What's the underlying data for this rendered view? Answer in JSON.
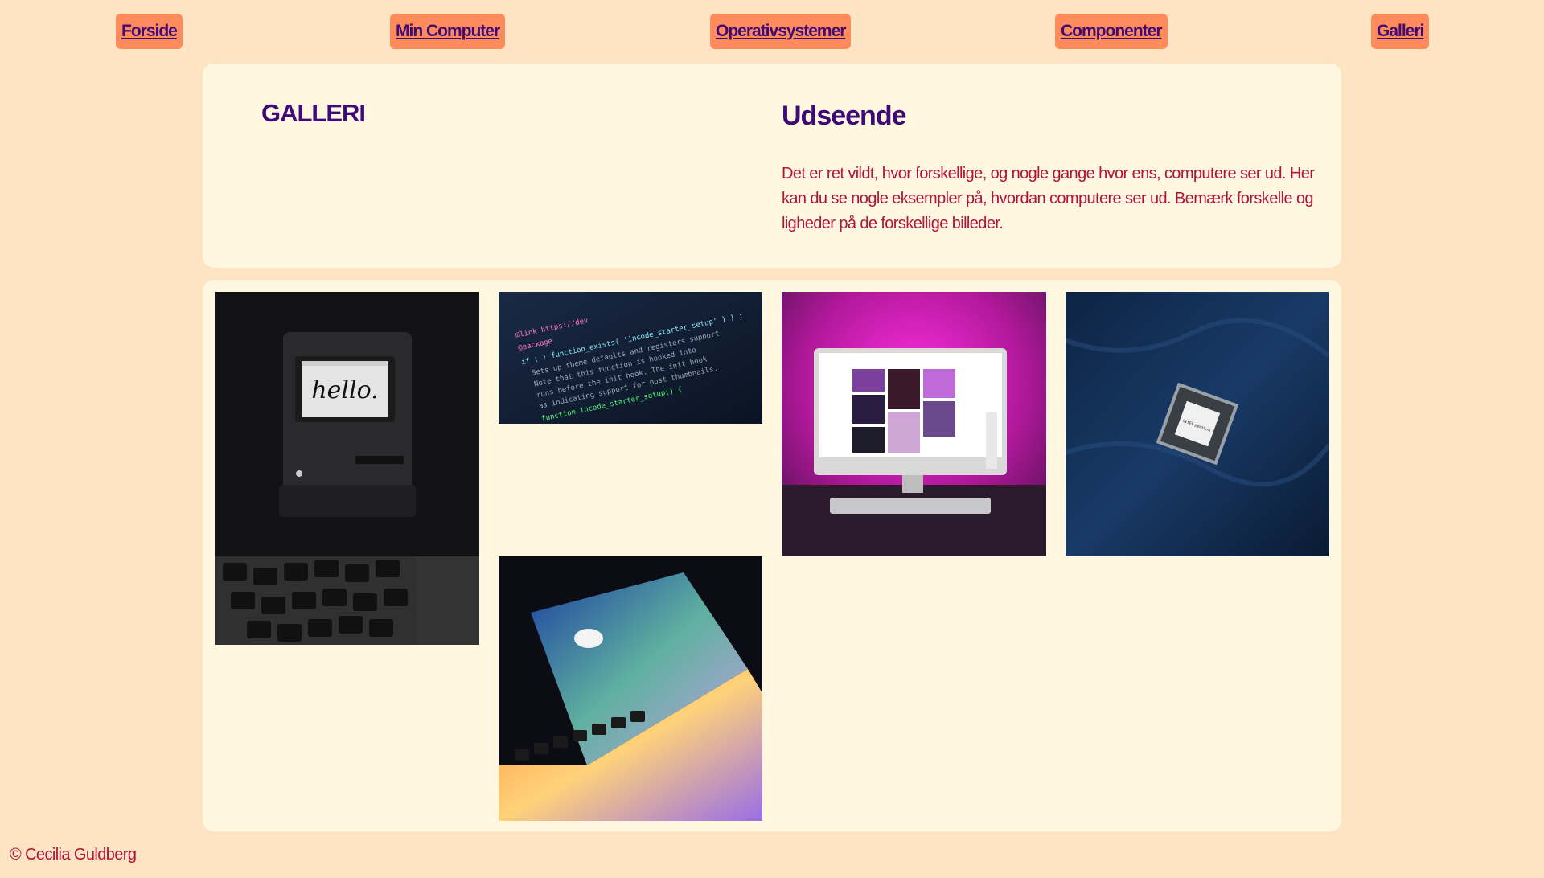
{
  "nav": {
    "items": [
      {
        "label": "Forside"
      },
      {
        "label": "Min Computer"
      },
      {
        "label": "Operativsystemer"
      },
      {
        "label": "Componenter"
      },
      {
        "label": "Galleri"
      }
    ]
  },
  "header": {
    "gallery_title": "GALLERI",
    "section_title": "Udseende",
    "intro_text": "Det er ret vildt, hvor forskellige, og nogle gange hvor ens, computere ser ud. Her kan du se nogle eksempler på, hvordan computere ser ud. Bemærk forskelle og ligheder på de forskellige billeder."
  },
  "gallery": {
    "mac_screen_text": "hello.",
    "code_lines": [
      "@link https://dev",
      "@package",
      "if ( ! function_exists( 'incode_starter_setup' ) ) :",
      "Sets up theme defaults and registers support",
      "Note that this function is hooked into",
      "runs before the init hook. The init hook",
      "as indicating support for post thumbnails.",
      "function incode_starter_setup() {"
    ],
    "chip_text": "INTEL pentium"
  },
  "footer": {
    "copyright": "© Cecilia Guldberg"
  },
  "colors": {
    "page_background": "#ffe4c4",
    "card_background": "#fff7df",
    "nav_button": "#ff8a5b",
    "heading": "#3d0a78",
    "body_text": "#b3123a"
  }
}
